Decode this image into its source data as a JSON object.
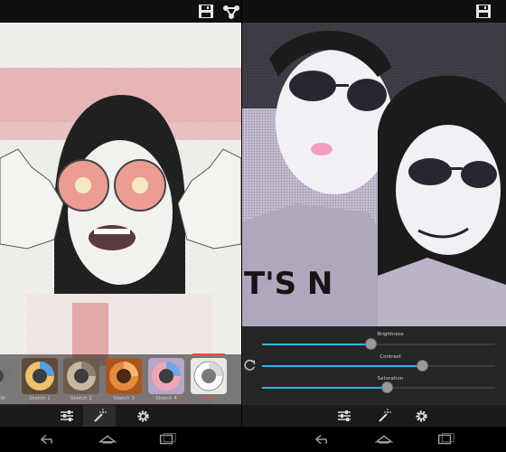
{
  "left_screen": {
    "actionbar": {
      "icons": [
        "save-icon",
        "share-icon",
        "settings-circle-icon"
      ]
    },
    "filters": [
      {
        "label": "&W",
        "icon": "sketch-bw-thumbnail"
      },
      {
        "label": "Sketch 1",
        "icon": "sketch-1-thumbnail"
      },
      {
        "label": "Sketch 2",
        "icon": "sketch-2-thumbnail"
      },
      {
        "label": "Sketch 3",
        "icon": "sketch-3-thumbnail"
      },
      {
        "label": "Sketch 4",
        "icon": "sketch-4-thumbnail"
      },
      {
        "label": "Pencil",
        "icon": "pencil-thumbnail",
        "selected": true
      }
    ],
    "toolbar": [
      "adjust-sliders-icon",
      "magic-wand-icon",
      "gear-icon"
    ]
  },
  "right_screen": {
    "actionbar": {
      "icons": [
        "save-icon"
      ]
    },
    "sliders": [
      {
        "label": "Brightness",
        "value": 0.47
      },
      {
        "label": "Contrast",
        "value": 0.69
      },
      {
        "label": "Saturation",
        "value": 0.54
      }
    ],
    "toolbar": [
      "adjust-sliders-icon",
      "magic-wand-icon",
      "gear-icon"
    ]
  },
  "navbar": [
    "back-icon",
    "home-icon",
    "recent-apps-icon"
  ],
  "colors": {
    "accent": "#33b5e5",
    "selected_filter": "#ff4a3a"
  }
}
